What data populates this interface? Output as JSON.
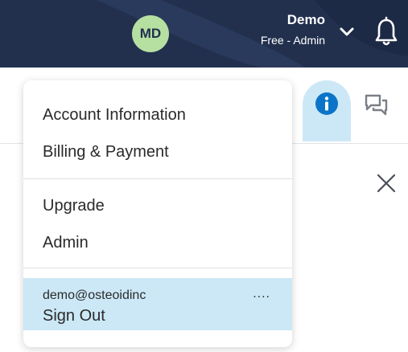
{
  "header": {
    "avatar_initials": "MD",
    "user_name": "Demo",
    "user_plan": "Free - Admin",
    "colors": {
      "bar": "#22304e",
      "avatar": "#b5e0a2"
    }
  },
  "toolbar": {
    "info_icon": "info-circle-icon",
    "chat_icon": "chat-bubbles-icon",
    "close_icon": "close-icon",
    "active_tab_color": "#cce8f6",
    "info_color": "#0b74c8"
  },
  "menu": {
    "items_group1": [
      "Account Information",
      "Billing & Payment"
    ],
    "items_group2": [
      "Upgrade",
      "Admin"
    ],
    "account": {
      "email": "demo@osteoidinc",
      "more": "....",
      "sign_out": "Sign Out"
    }
  }
}
